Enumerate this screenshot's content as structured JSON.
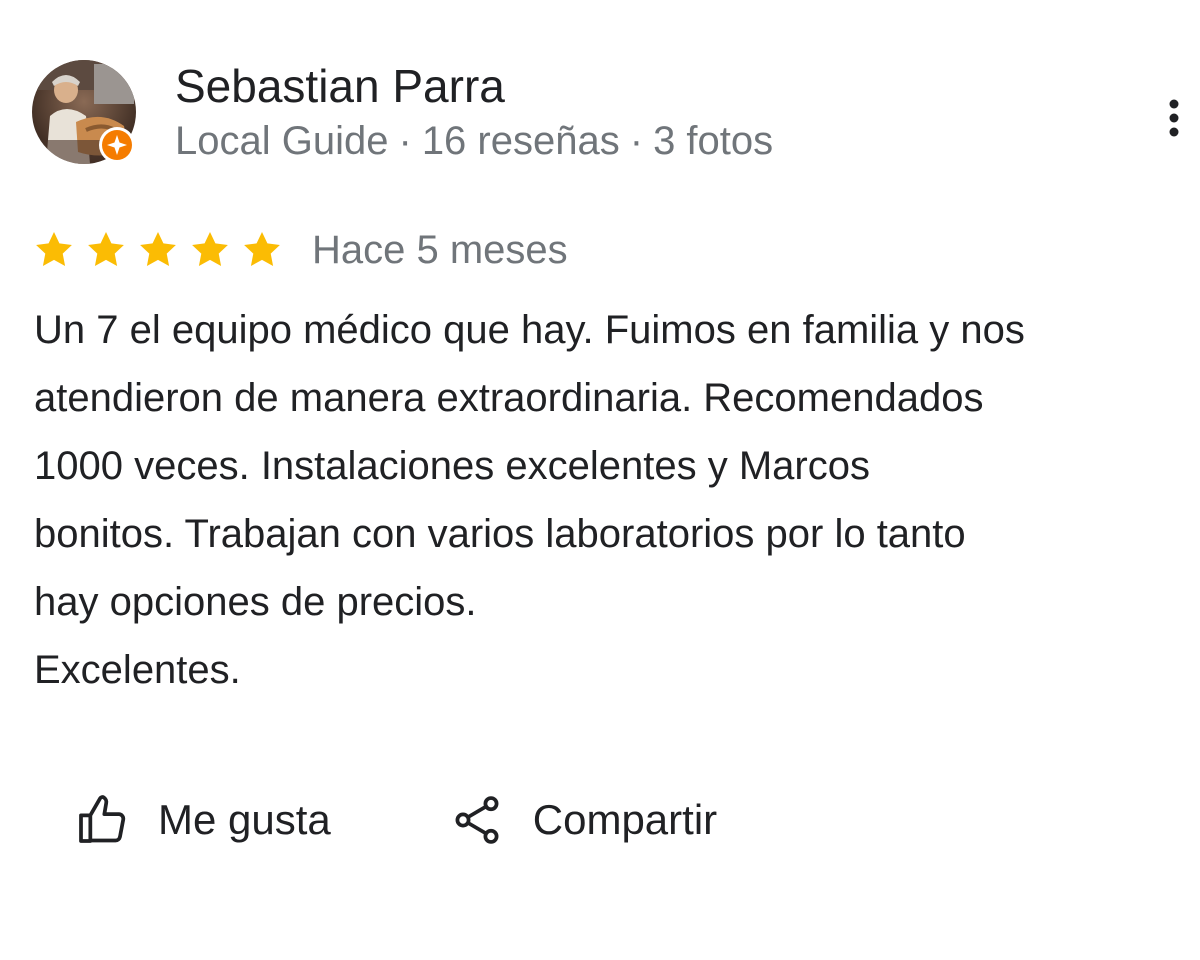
{
  "review": {
    "author_name": "Sebastian Parra",
    "author_level": "Local Guide",
    "review_count": "16 reseñas",
    "photo_count": "3 fotos",
    "meta_separator": "·",
    "rating": 5,
    "rating_max": 5,
    "date": "Hace 5 meses",
    "text": "Un 7 el equipo médico que hay. Fuimos en familia y nos\natendieron de manera extraordinaria. Recomendados\n1000 veces. Instalaciones excelentes y Marcos\nbonitos. Trabajan con varios laboratorios por lo tanto\nhay opciones de precios.\nExcelentes."
  },
  "actions": {
    "like_label": "Me gusta",
    "share_label": "Compartir"
  },
  "icons": {
    "avatar": "avatar-photo",
    "badge": "local-guide-badge-icon",
    "more": "more-vert-icon",
    "star": "star-icon",
    "like": "thumb-up-icon",
    "share": "share-icon"
  },
  "colors": {
    "star": "#FBBC04",
    "badge": "#F57C00",
    "text_primary": "#202124",
    "text_secondary": "#70757a"
  }
}
